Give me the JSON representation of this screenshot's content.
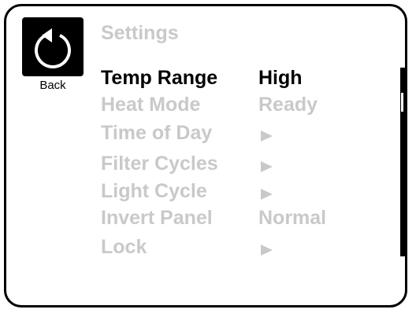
{
  "header": {
    "title": "Settings"
  },
  "back": {
    "label": "Back",
    "icon": "back-arrow-icon"
  },
  "menu": [
    {
      "name": "temp-range",
      "label": "Temp Range",
      "value": "High",
      "selected": true
    },
    {
      "name": "heat-mode",
      "label": "Heat Mode",
      "value": "Ready",
      "selected": false
    },
    {
      "name": "time-of-day",
      "label": "Time of Day",
      "value": "",
      "icon": "arrow-right-icon",
      "selected": false
    },
    {
      "name": "filter-cycles",
      "label": "Filter Cycles",
      "value": "",
      "icon": "arrow-right-icon",
      "selected": false
    },
    {
      "name": "light-cycle",
      "label": "Light Cycle",
      "value": "",
      "icon": "arrow-right-icon",
      "selected": false
    },
    {
      "name": "invert-panel",
      "label": "Invert Panel",
      "value": "Normal",
      "selected": false
    },
    {
      "name": "lock",
      "label": "Lock",
      "value": "",
      "icon": "arrow-right-icon",
      "selected": false
    }
  ],
  "colors": {
    "selected_text": "#000000",
    "dimmed_text": "#c9c9c9",
    "border": "#000000",
    "background": "#ffffff"
  }
}
